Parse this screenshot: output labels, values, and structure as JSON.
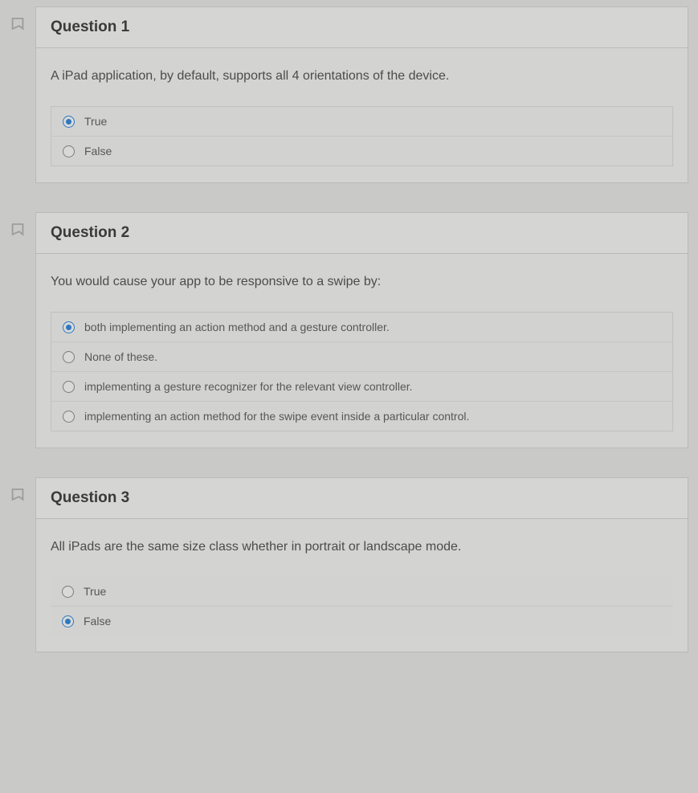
{
  "questions": [
    {
      "title": "Question 1",
      "prompt": "A iPad application, by default, supports all 4 orientations of the device.",
      "options": [
        {
          "label": "True",
          "selected": true
        },
        {
          "label": "False",
          "selected": false
        }
      ]
    },
    {
      "title": "Question 2",
      "prompt": "You would cause your app to be responsive to a swipe by:",
      "options": [
        {
          "label": "both implementing an action method and a gesture controller.",
          "selected": true
        },
        {
          "label": "None of these.",
          "selected": false
        },
        {
          "label": "implementing a gesture recognizer for the relevant view controller.",
          "selected": false
        },
        {
          "label": "implementing an action method for the swipe event inside a particular control.",
          "selected": false
        }
      ]
    },
    {
      "title": "Question 3",
      "prompt": "All iPads are the same size class whether in portrait or landscape mode.",
      "options": [
        {
          "label": "True",
          "selected": false
        },
        {
          "label": "False",
          "selected": true
        }
      ]
    }
  ]
}
